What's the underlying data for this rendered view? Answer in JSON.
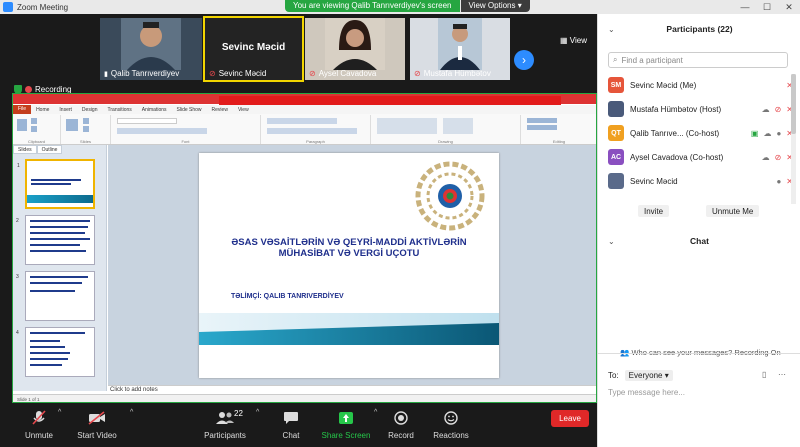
{
  "window": {
    "title": "Zoom Meeting"
  },
  "banner": {
    "viewing": "You are viewing Qalib Tanrıverdiyev's screen",
    "view_options": "View Options ▾"
  },
  "video_strip": {
    "tiles": [
      {
        "name": "Qalib Tanrıverdiyev",
        "muted": false
      },
      {
        "name": "Sevinc Məcid",
        "big_name": "Sevinc Məcid",
        "muted": true
      },
      {
        "name": "Aysel Cavadova",
        "muted": true
      },
      {
        "name": "Mustafa Hümbətov",
        "muted": true
      }
    ],
    "view_label": "View"
  },
  "recording": {
    "label": "Recording"
  },
  "ppt": {
    "tabs": [
      "File",
      "Home",
      "Insert",
      "Design",
      "Transitions",
      "Animations",
      "Slide Show",
      "Review",
      "View"
    ],
    "groups": [
      "Clipboard",
      "Slides",
      "Font",
      "Paragraph",
      "Drawing",
      "Editing"
    ],
    "left_tabs": [
      "Slides",
      "Outline"
    ],
    "slide": {
      "title": "ƏSAS VƏSAİTLƏRİN VƏ QEYRİ-MADDİ AKTİVLƏRİN MÜHASİBAT VƏ VERGİ UÇOTU",
      "subtitle": "TƏLİMÇİ: QALIB TANRIVERDİYEV"
    },
    "notes_placeholder": "Click to add notes",
    "status": "Slide 1 of 1"
  },
  "toolbar": {
    "unmute": "Unmute",
    "start_video": "Start Video",
    "participants": "Participants",
    "participants_count": "22",
    "chat": "Chat",
    "share_screen": "Share Screen",
    "record": "Record",
    "reactions": "Reactions",
    "leave": "Leave"
  },
  "panel": {
    "participants_title": "Participants (22)",
    "search_placeholder": "Find a participant",
    "participants": [
      {
        "initials": "SM",
        "name": "Sevinc Məcid (Me)",
        "color": "#e6553a"
      },
      {
        "initials": "",
        "name": "Mustafa Hümbətov (Host)",
        "color": "#4a5a7a"
      },
      {
        "initials": "QT",
        "name": "Qalib Tanrıve...  (Co-host)",
        "color": "#f0a020"
      },
      {
        "initials": "AC",
        "name": "Aysel Cavadova (Co-host)",
        "color": "#8a4fc0"
      },
      {
        "initials": "",
        "name": "Sevinc Məcid",
        "color": "#5a6a8a"
      }
    ],
    "invite": "Invite",
    "unmute_me": "Unmute Me",
    "chat_title": "Chat",
    "who_can_see": "Who can see your messages? Recording On",
    "to_label": "To:",
    "to_value": "Everyone",
    "message_placeholder": "Type message here..."
  }
}
